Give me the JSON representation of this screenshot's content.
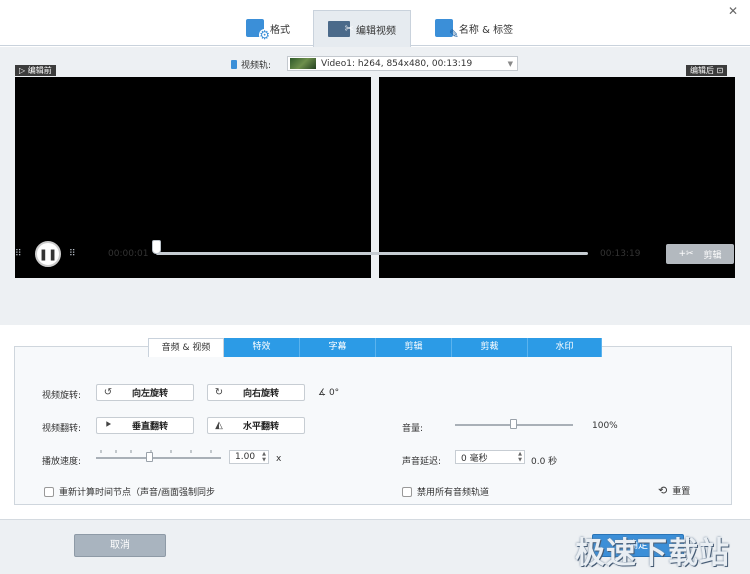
{
  "tabs": [
    {
      "label": "格式",
      "icon": "format-gear-icon",
      "active": false
    },
    {
      "label": "编辑视频",
      "icon": "edit-video-icon",
      "active": true
    },
    {
      "label": "名称 & 标签",
      "icon": "tag-edit-icon",
      "active": false
    }
  ],
  "close_icon": "close-icon",
  "video": {
    "before_label": "▷ 编辑前",
    "after_label": "编辑后 ⊡",
    "track_label": "视频轨:",
    "track_value": "Video1: h264, 854x480, 00:13:19",
    "time_start": "00:00:01",
    "time_end": "00:13:19",
    "cut_button": "剪辑",
    "progress": 0.0
  },
  "settings_tabs": [
    "音频 & 视频",
    "特效",
    "字幕",
    "剪辑",
    "剪裁",
    "水印"
  ],
  "settings": {
    "rotate_label": "视频旋转:",
    "rotate_left": "向左旋转",
    "rotate_right": "向右旋转",
    "rotate_angle": "0°",
    "flip_label": "视频翻转:",
    "flip_vertical": "垂直翻转",
    "flip_horizontal": "水平翻转",
    "speed_label": "播放速度:",
    "speed_value": "1.00",
    "speed_unit": "x",
    "volume_label": "音量:",
    "volume_value": "100%",
    "volume_level": 0.5,
    "delay_label": "声音延迟:",
    "delay_value": "0 毫秒",
    "delay_seconds": "0.0 秒",
    "recalc_label": "重新计算时间节点（声音/画面强制同步",
    "disable_audio_label": "禁用所有音频轨道",
    "reset_label": "重置"
  },
  "footer": {
    "cancel": "取消",
    "ok": "确定",
    "watermark": "极速下载站"
  }
}
